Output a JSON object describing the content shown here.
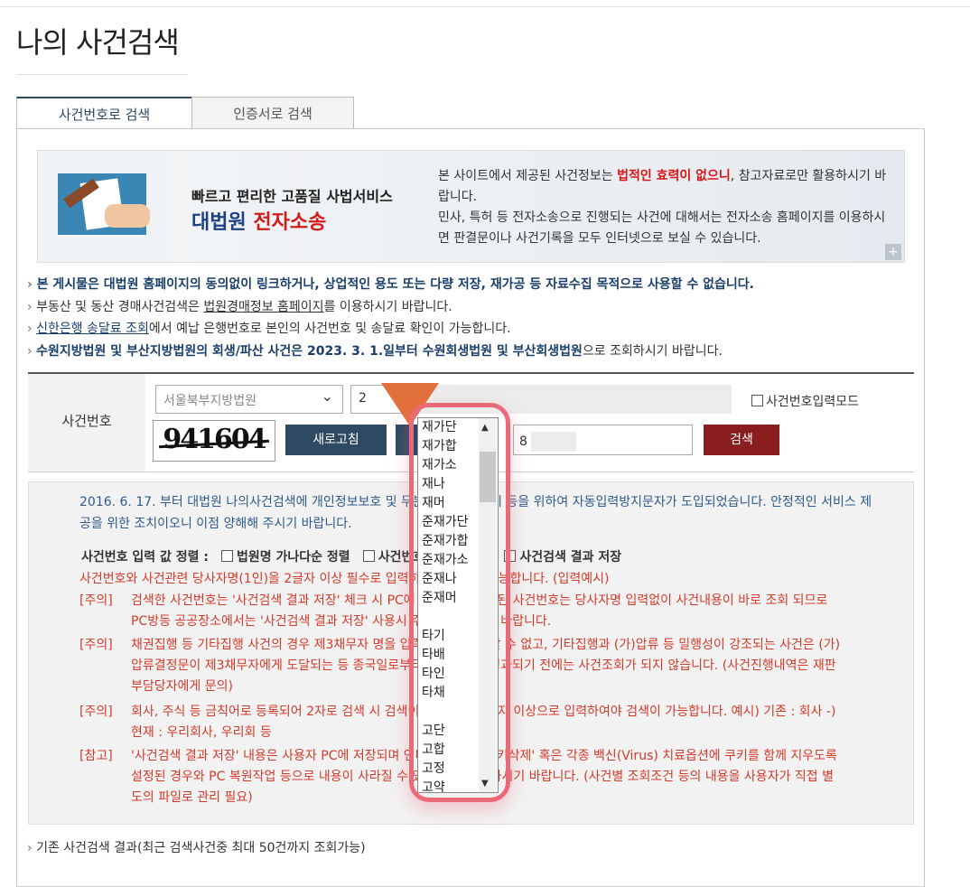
{
  "page": {
    "title": "나의 사건검색",
    "tabs": [
      "사건번호로 검색",
      "인증서로 검색"
    ]
  },
  "banner": {
    "line1": "빠르고 편리한 고품질 사법서비스",
    "line2_a": "대법원 ",
    "line2_b": "전자소송",
    "right_a": "본 사이트에서 제공된 사건정보는 ",
    "right_b": "법적인 효력이 없으니",
    "right_c": ", 참고자료로만 활용하시기 바랍니다.",
    "right_d": "민사, 특허 등 전자소송으로 진행되는 사건에 대해서는 전자소송 홈페이지를 이용하시면 판결문이나 사건기록을 모두 인터넷으로 보실 수 있습니다.",
    "plus": "+"
  },
  "notes": {
    "n1": "본 게시물은 대법원 홈페이지의 동의없이 링크하거나, 상업적인 용도 또는 다량 저장, 재가공 등 자료수집 목적으로 사용할 수 없습니다.",
    "n2_a": "부동산 및 동산 경매사건검색은 ",
    "n2_link": "법원경매정보 홈페이지",
    "n2_b": "를 이용하시기 바랍니다.",
    "n3_link": "신한은행 송달료 조회",
    "n3_b": "에서 예납 은행번호로 본인의 사건번호 및 송달료 확인이 가능합니다.",
    "n4_a": "수원지방법원 및 부산지방법원의 회생/파산 사건은 2023. 3. 1.일부터 수원회생법원 및 부산회생법원",
    "n4_b": "으로 조회하시기 바랍니다."
  },
  "form": {
    "label": "사건번호",
    "court_select_value": "서울북부지방법원",
    "year_value": "2",
    "mode_label": "사건번호입력모드",
    "captcha_text": "941604",
    "refresh_button": "새로고침",
    "captcha_input_value": "8",
    "search_button": "검색"
  },
  "dropdown": {
    "items_a": [
      "재가단",
      "재가합",
      "재가소",
      "재나",
      "재머",
      "준재가단",
      "준재가합",
      "준재가소",
      "준재나",
      "준재머"
    ],
    "items_b": [
      "타기",
      "타배",
      "타인",
      "타채"
    ],
    "items_c": [
      "고단",
      "고합",
      "고정",
      "고약"
    ]
  },
  "info": {
    "p1": "2016. 6. 17. 부터 대법원 나의사건검색에 개인정보보호 및 무분별한 수집 방지 등을 위하여 자동입력방지문자가 도입되었습니다. 안정적인 서비스 제공을 위한 조치이오니 이점 양해해 주시기 바랍니다.",
    "opt_title": "사건번호 입력 값 정렬 :",
    "opt1": "법원명 가나다순 정렬",
    "opt2": "사건번호 입력순 정렬",
    "opt3": "사건검색 결과 저장",
    "r1": "사건번호와 사건관련 당사자명(1인)을 2글자 이상 필수로 입력하셔야 검색이 가능합니다. (입력예시)",
    "t1": "[주의]",
    "r2": "검색한 사건번호는 '사건검색 결과 저장' 체크 시 PC에 저장되며, 저장된 사건번호는 당사자명 입력없이 사건내용이 바로 조회 되므로 PC방등 공공장소에서는 '사건검색 결과 저장' 사용시 주의하여 주시기 바랍니다.",
    "t2": "[주의]",
    "r3": "채권집행 등 기타집행 사건의 경우 제3채무자 명을 입력하여 검색을 할 수 없고, 기타집행과 (가)압류 등 밀행성이 강조되는 사건은 (가)압류결정문이 제3채무자에게 도달되는 등 종국일로부터 일정기간이 경과되기 전에는 사건조회가 되지 않습니다. (사건진행내역은 재판부담당자에게 문의)",
    "t3": "[주의]",
    "r4": "회사, 주식 등 금칙어로 등록되어 2자로 검색 시 검색이 불가합니다. 3자 이상으로 입력하여야 검색이 가능합니다. 예시) 기존 : 회사 -) 현재 : 우리회사, 우리회 등",
    "t4": "[참고]",
    "r5": "'사건검색 결과 저장' 내용은 사용자 PC에 저장되며 인터넷 옵션의 '쿠키삭제' 혹은 각종 백신(Virus) 치료옵션에 쿠키를 함께 지우도록 설정된 경우와 PC 복원작업 등으로 내용이 사라질 수 있으므로 유의 하시기 바랍니다. (사건별 조회조건 등의 내용을 사용자가 직접 별도의 파일로 관리 필요)"
  },
  "bottom": "기존 사건검색 결과(최근 검색사건중 최대 50건까지 조회가능)",
  "colors": {
    "accent": "#2e4a63",
    "search": "#8a1d1d",
    "highlight": "#ea6a78",
    "arrow": "#e2703b"
  }
}
